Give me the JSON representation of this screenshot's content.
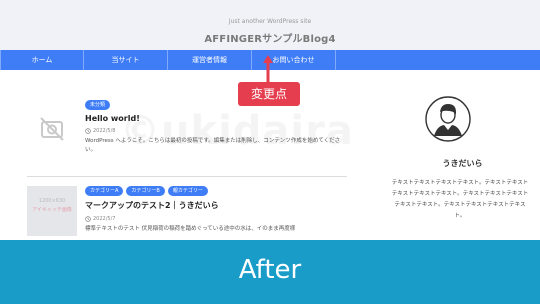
{
  "header": {
    "tagline": "Just another WordPress site",
    "site_title": "AFFINGERサンプルBlog4"
  },
  "nav": {
    "items": [
      "ホーム",
      "当サイト",
      "運営者情報",
      "お問い合わせ"
    ]
  },
  "callout": {
    "label": "変更点"
  },
  "watermark": "©ukidaira",
  "posts": [
    {
      "badges": [
        "未分類"
      ],
      "title": "Hello world!",
      "date": "2022/5/8",
      "excerpt": "WordPress へようこそ。こちらは最初の投稿です。編集または削除し、コンテンツ作成を始めてください。"
    },
    {
      "badges": [
        "カテゴリーA",
        "カテゴリーB",
        "親カテゴリー"
      ],
      "title": "マークアップのテスト2｜うきだいら",
      "date": "2022/5/7",
      "excerpt": "標準テキストのテスト 伏見稲荷の稲荷を踏めぐっている途中の水は、イのまま再度様",
      "thumb_text": "1200×630",
      "thumb_subtext": "アイキャッチ画像"
    }
  ],
  "sidebar": {
    "author_name": "うきだいら",
    "description": "テキストテキストテキストテキスト。テキストテキストテキストテキストテキスト。テキストテキストテキストテキストテキスト。テキストテキストテキストテキスト。"
  },
  "banner": {
    "label": "After"
  },
  "colors": {
    "nav": "#3f7df7",
    "callout": "#e53e4f",
    "banner": "#1a9cc9"
  }
}
